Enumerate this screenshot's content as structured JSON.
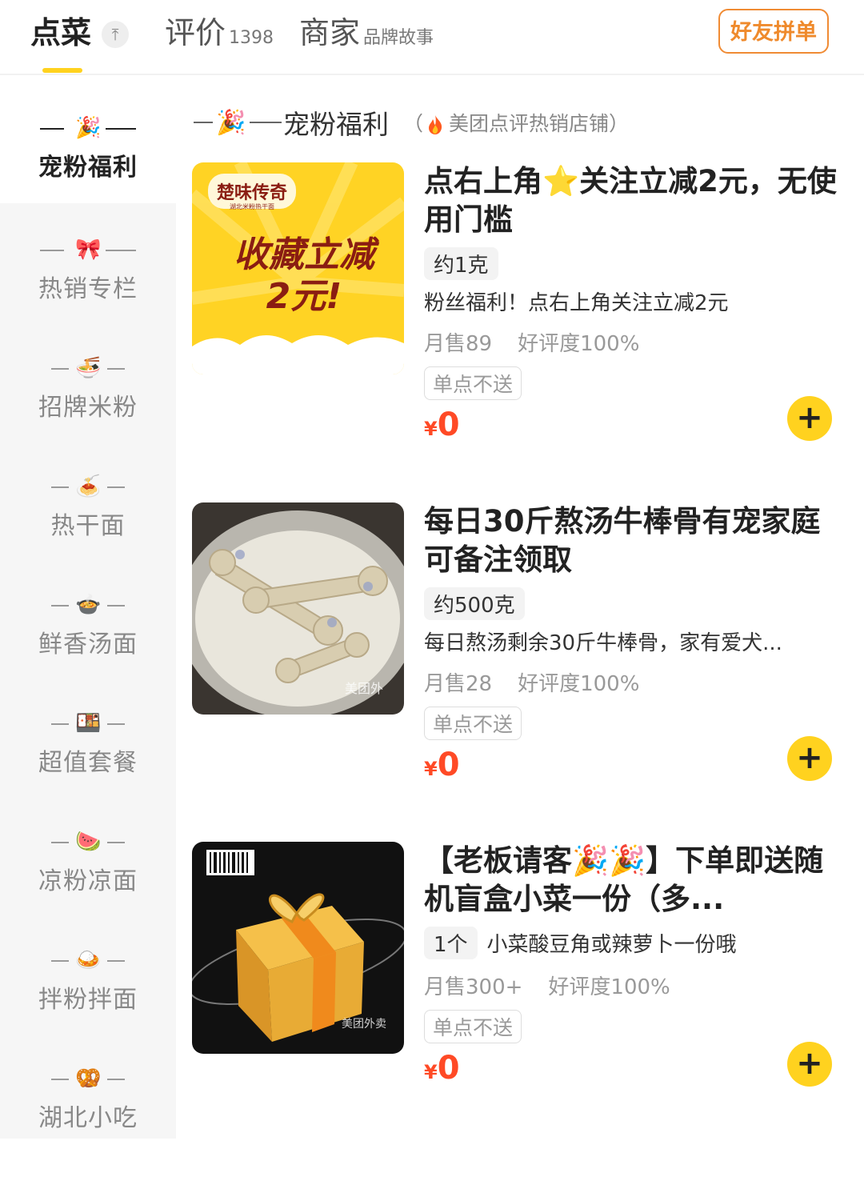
{
  "tabs": [
    {
      "label": "点菜",
      "sub": "",
      "active": true
    },
    {
      "label": "评价",
      "sub": "1398",
      "active": false
    },
    {
      "label": "商家",
      "sub": "品牌故事",
      "active": false
    }
  ],
  "pin_icon": "pin-top-icon",
  "group_order_label": "好友拼单",
  "sidebar": {
    "items": [
      {
        "label": "宠粉福利",
        "icon": "party-popper-icon",
        "emoji": "🎉",
        "active": true
      },
      {
        "label": "热销专栏",
        "icon": "ribbon-icon",
        "emoji": "🎀",
        "active": false
      },
      {
        "label": "招牌米粉",
        "icon": "noodle-bowl-icon",
        "emoji": "🍜",
        "active": false
      },
      {
        "label": "热干面",
        "icon": "spaghetti-icon",
        "emoji": "🍝",
        "active": false
      },
      {
        "label": "鲜香汤面",
        "icon": "soup-bowl-icon",
        "emoji": "🍲",
        "active": false
      },
      {
        "label": "超值套餐",
        "icon": "bento-icon",
        "emoji": "🍱",
        "active": false
      },
      {
        "label": "凉粉凉面",
        "icon": "watermelon-icon",
        "emoji": "🍉",
        "active": false
      },
      {
        "label": "拌粉拌面",
        "icon": "rice-bowl-icon",
        "emoji": "🍛",
        "active": false
      },
      {
        "label": "湖北小吃",
        "icon": "pretzel-icon",
        "emoji": "🥨",
        "active": false
      }
    ]
  },
  "section": {
    "title": "宠粉福利",
    "note_open": "（",
    "note": "美团点评热销店铺",
    "note_close": "）",
    "icon": "party-popper-icon"
  },
  "products": [
    {
      "title": "点右上角⭐️关注立减2元，无使用门槛",
      "weight": "约1克",
      "desc": "粉丝福利！点右上角关注立减2元",
      "inline_desc": "",
      "sales": "月售89",
      "rating": "好评度100%",
      "delivery_note": "单点不送",
      "currency": "¥",
      "price": "0",
      "image_text": {
        "brand": "楚味传奇",
        "brand_sub": "湖北米粉热干面",
        "promo_line1": "收藏立减",
        "promo_line2": "2元!"
      }
    },
    {
      "title": "每日30斤熬汤牛棒骨有宠家庭可备注领取",
      "weight": "约500克",
      "desc": "每日熬汤剩余30斤牛棒骨，家有爱犬...",
      "inline_desc": "",
      "sales": "月售28",
      "rating": "好评度100%",
      "delivery_note": "单点不送",
      "currency": "¥",
      "price": "0",
      "image_text": {
        "watermark": "美团外"
      }
    },
    {
      "title": "【老板请客🎉🎉】下单即送随机盲盒小菜一份（多...",
      "weight": "1个",
      "desc": "",
      "inline_desc": "小菜酸豆角或辣萝卜一份哦",
      "sales": "月售300+",
      "rating": "好评度100%",
      "delivery_note": "单点不送",
      "currency": "¥",
      "price": "0",
      "image_text": {
        "watermark": "美团外卖"
      }
    }
  ],
  "colors": {
    "accent": "#FFD21F",
    "price": "#FF4A26",
    "group_btn": "#F08B34"
  }
}
